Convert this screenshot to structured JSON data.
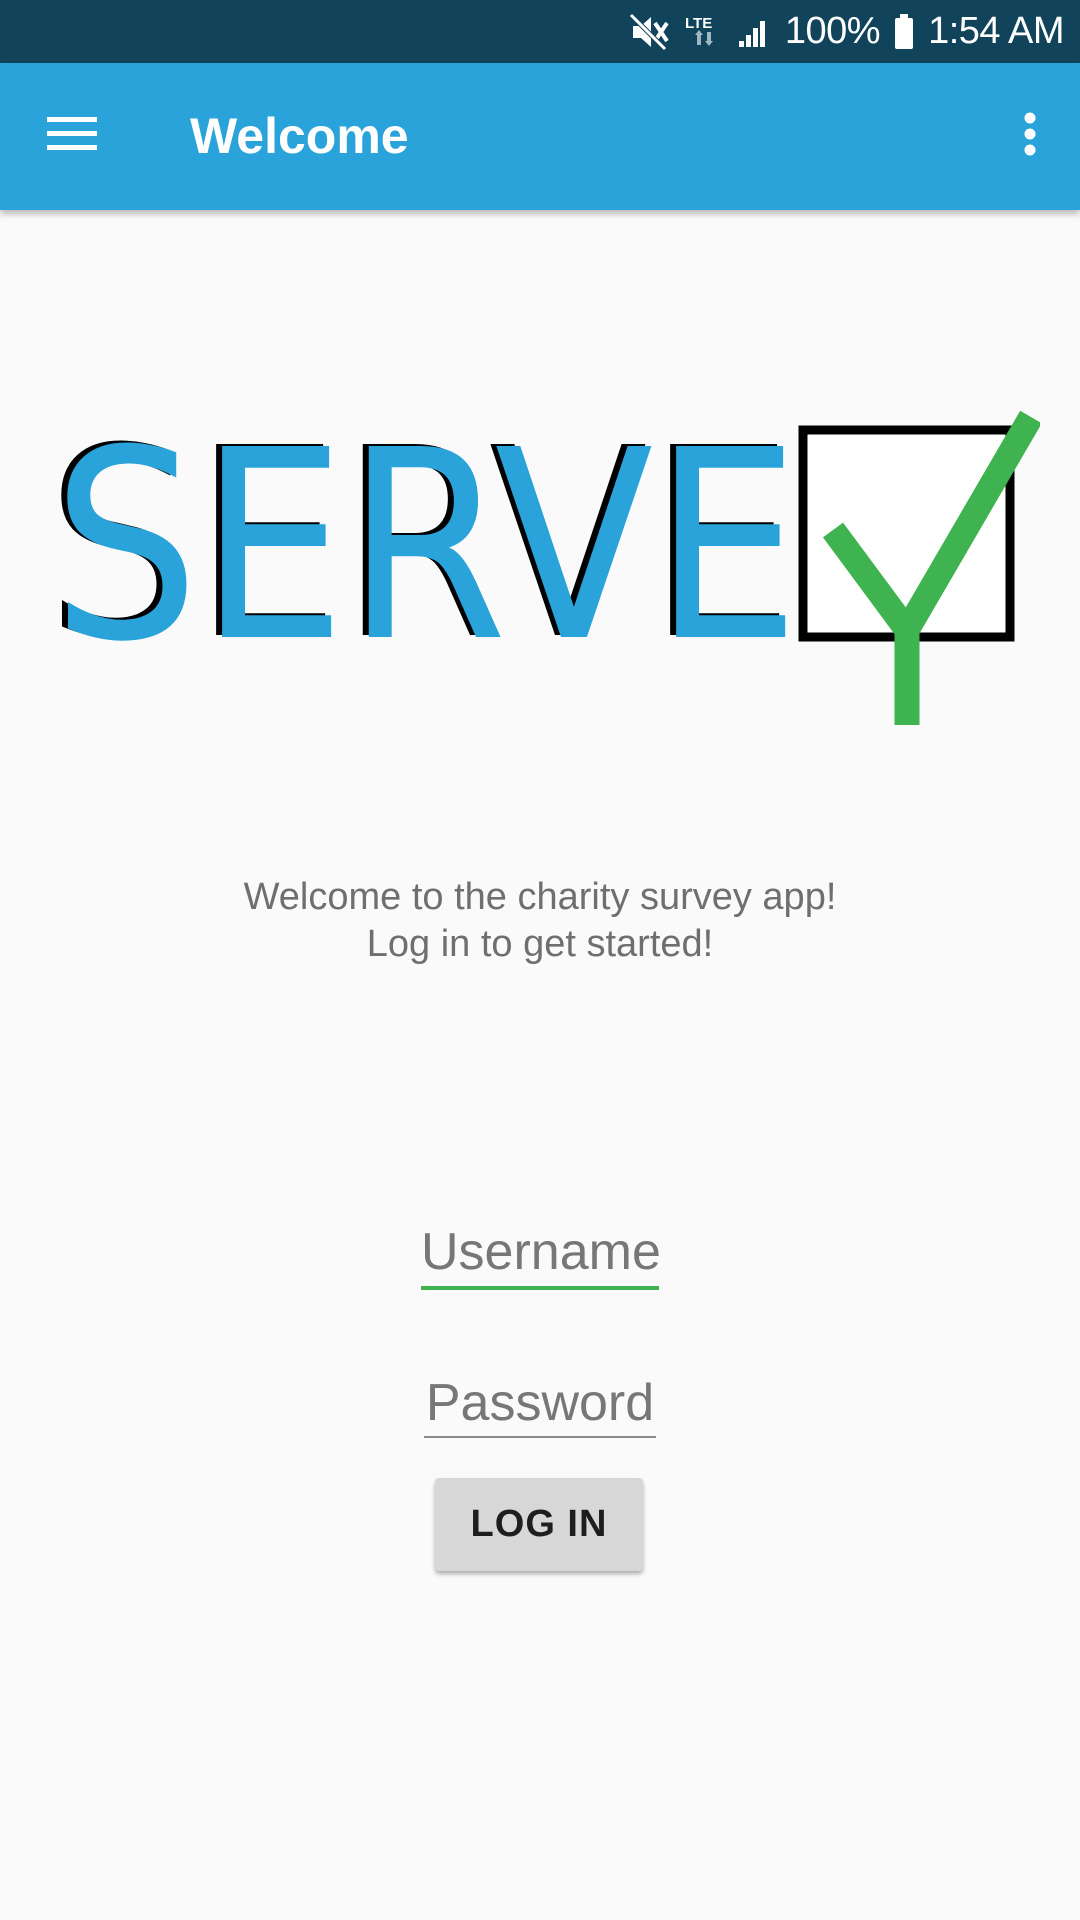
{
  "status_bar": {
    "battery": "100%",
    "time": "1:54 AM",
    "network_label": "LTE",
    "icons": [
      "mute-icon",
      "lte-icon",
      "signal-icon",
      "battery-icon"
    ]
  },
  "app_bar": {
    "title": "Welcome",
    "menu_icon": "hamburger-icon",
    "overflow_icon": "more-vert-icon"
  },
  "logo": {
    "text": "SERVEY",
    "letters_blue": "SERVE",
    "letter_check": "Y",
    "colors": {
      "blue": "#29a3da",
      "green": "#3fb350",
      "black": "#000000"
    }
  },
  "welcome": {
    "line1": "Welcome to the charity survey app!",
    "line2": "Log in to get started!"
  },
  "form": {
    "username_placeholder": "Username",
    "password_placeholder": "Password",
    "login_label": "LOG IN"
  },
  "colors": {
    "status_bar": "#11435a",
    "app_bar": "#29a3da",
    "accent": "#3fb350",
    "background": "#fafafa"
  }
}
